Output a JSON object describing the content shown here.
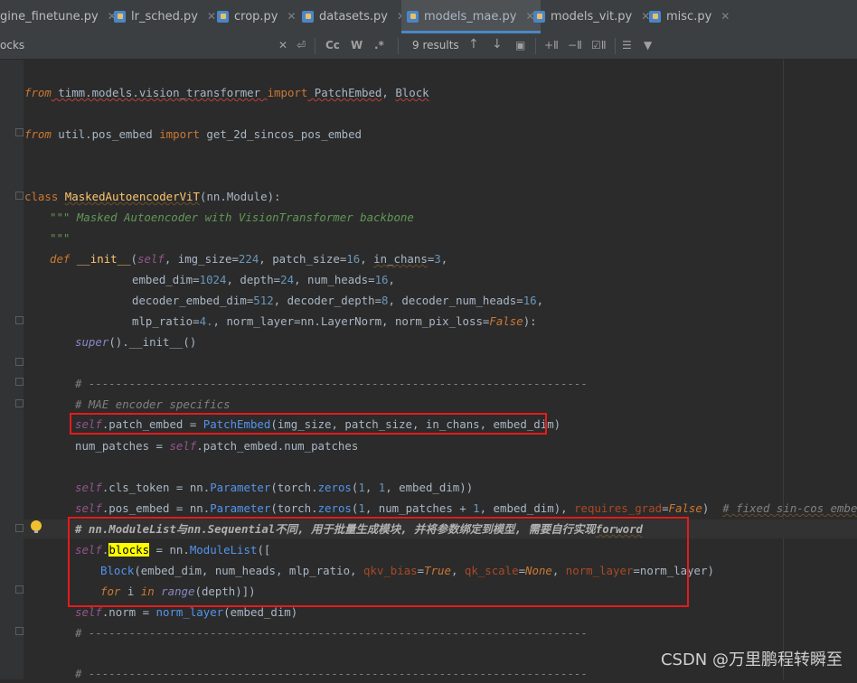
{
  "tabs": [
    {
      "label": "gine_finetune.py"
    },
    {
      "label": "lr_sched.py"
    },
    {
      "label": "crop.py"
    },
    {
      "label": "datasets.py"
    },
    {
      "label": "models_mae.py",
      "active": true
    },
    {
      "label": "models_vit.py"
    },
    {
      "label": "misc.py"
    }
  ],
  "search": {
    "query": "ocks",
    "case_toggle": "Cc",
    "word_toggle": "W",
    "regex_toggle": ".*",
    "results": "9 results"
  },
  "code": {
    "l1": [
      "from",
      " timm.models.vision_transformer ",
      "import",
      " PatchEmbed",
      ", ",
      "Block"
    ],
    "l2": [
      "from",
      " util.pos_embed ",
      "import",
      " get_2d_sincos_pos_embed"
    ],
    "l3": [
      "class",
      " ",
      "MaskedAutoencoderViT",
      "(nn.Module):"
    ],
    "l4": "\"\"\" Masked Autoencoder with VisionTransformer backbone",
    "l5": "\"\"\"",
    "l6": [
      "def",
      " __init__",
      "(",
      "self",
      ", img_size=",
      "224",
      ", patch_size=",
      "16",
      ", ",
      "in_chans",
      "=",
      "3",
      ","
    ],
    "l7": [
      "embed_dim=",
      "1024",
      ", depth=",
      "24",
      ", num_heads=",
      "16",
      ","
    ],
    "l8": [
      "decoder_embed_dim=",
      "512",
      ", decoder_depth=",
      "8",
      ", decoder_num_heads=",
      "16",
      ","
    ],
    "l9": [
      "mlp_ratio=",
      "4.",
      ", norm_layer=nn.LayerNorm, norm_pix_loss=",
      "False",
      "):"
    ],
    "l10": [
      "super",
      "().__init__()"
    ],
    "l11": "# --------------------------------------------------------------------------",
    "l12": "# MAE encoder specifics",
    "l13": [
      "self",
      ".patch_embed = ",
      "PatchEmbed",
      "(img_size, patch_size, in_chans, embed_dim)"
    ],
    "l14": [
      "num_patches = ",
      "self",
      ".patch_embed.num_patches"
    ],
    "l15": [
      "self",
      ".cls_token = nn.",
      "Parameter",
      "(torch.",
      "zeros",
      "(",
      "1",
      ", ",
      "1",
      ", embed_dim))"
    ],
    "l16": [
      "self",
      ".pos_embed = nn.",
      "Parameter",
      "(torch.",
      "zeros",
      "(",
      "1",
      ", num_patches + ",
      "1",
      ", embed_dim), ",
      "requires_grad",
      "=",
      "False",
      ")  ",
      "# fixed sin-cos embedding"
    ],
    "l17": [
      "# nn.ModuleList与nn.Sequential不同, 用于批量生成模块, 并将参数绑定到模型, 需要自行实现",
      "forword"
    ],
    "l18": [
      "self",
      ".",
      "blocks",
      " = nn.",
      "ModuleList",
      "(["
    ],
    "l19": [
      "Block",
      "(embed_dim, num_heads, mlp_ratio, ",
      "qkv_bias",
      "=",
      "True",
      ", ",
      "qk_scale",
      "=",
      "None",
      ", ",
      "norm_layer",
      "=norm_layer)"
    ],
    "l20": [
      "for",
      " i ",
      "in",
      " ",
      "range",
      "(depth)])"
    ],
    "l21": [
      "self",
      ".norm = ",
      "norm_layer",
      "(embed_dim)"
    ],
    "l22": "# --------------------------------------------------------------------------",
    "l23": "# --------------------------------------------------------------------------"
  },
  "watermark": "CSDN @万里鹏程转瞬至"
}
